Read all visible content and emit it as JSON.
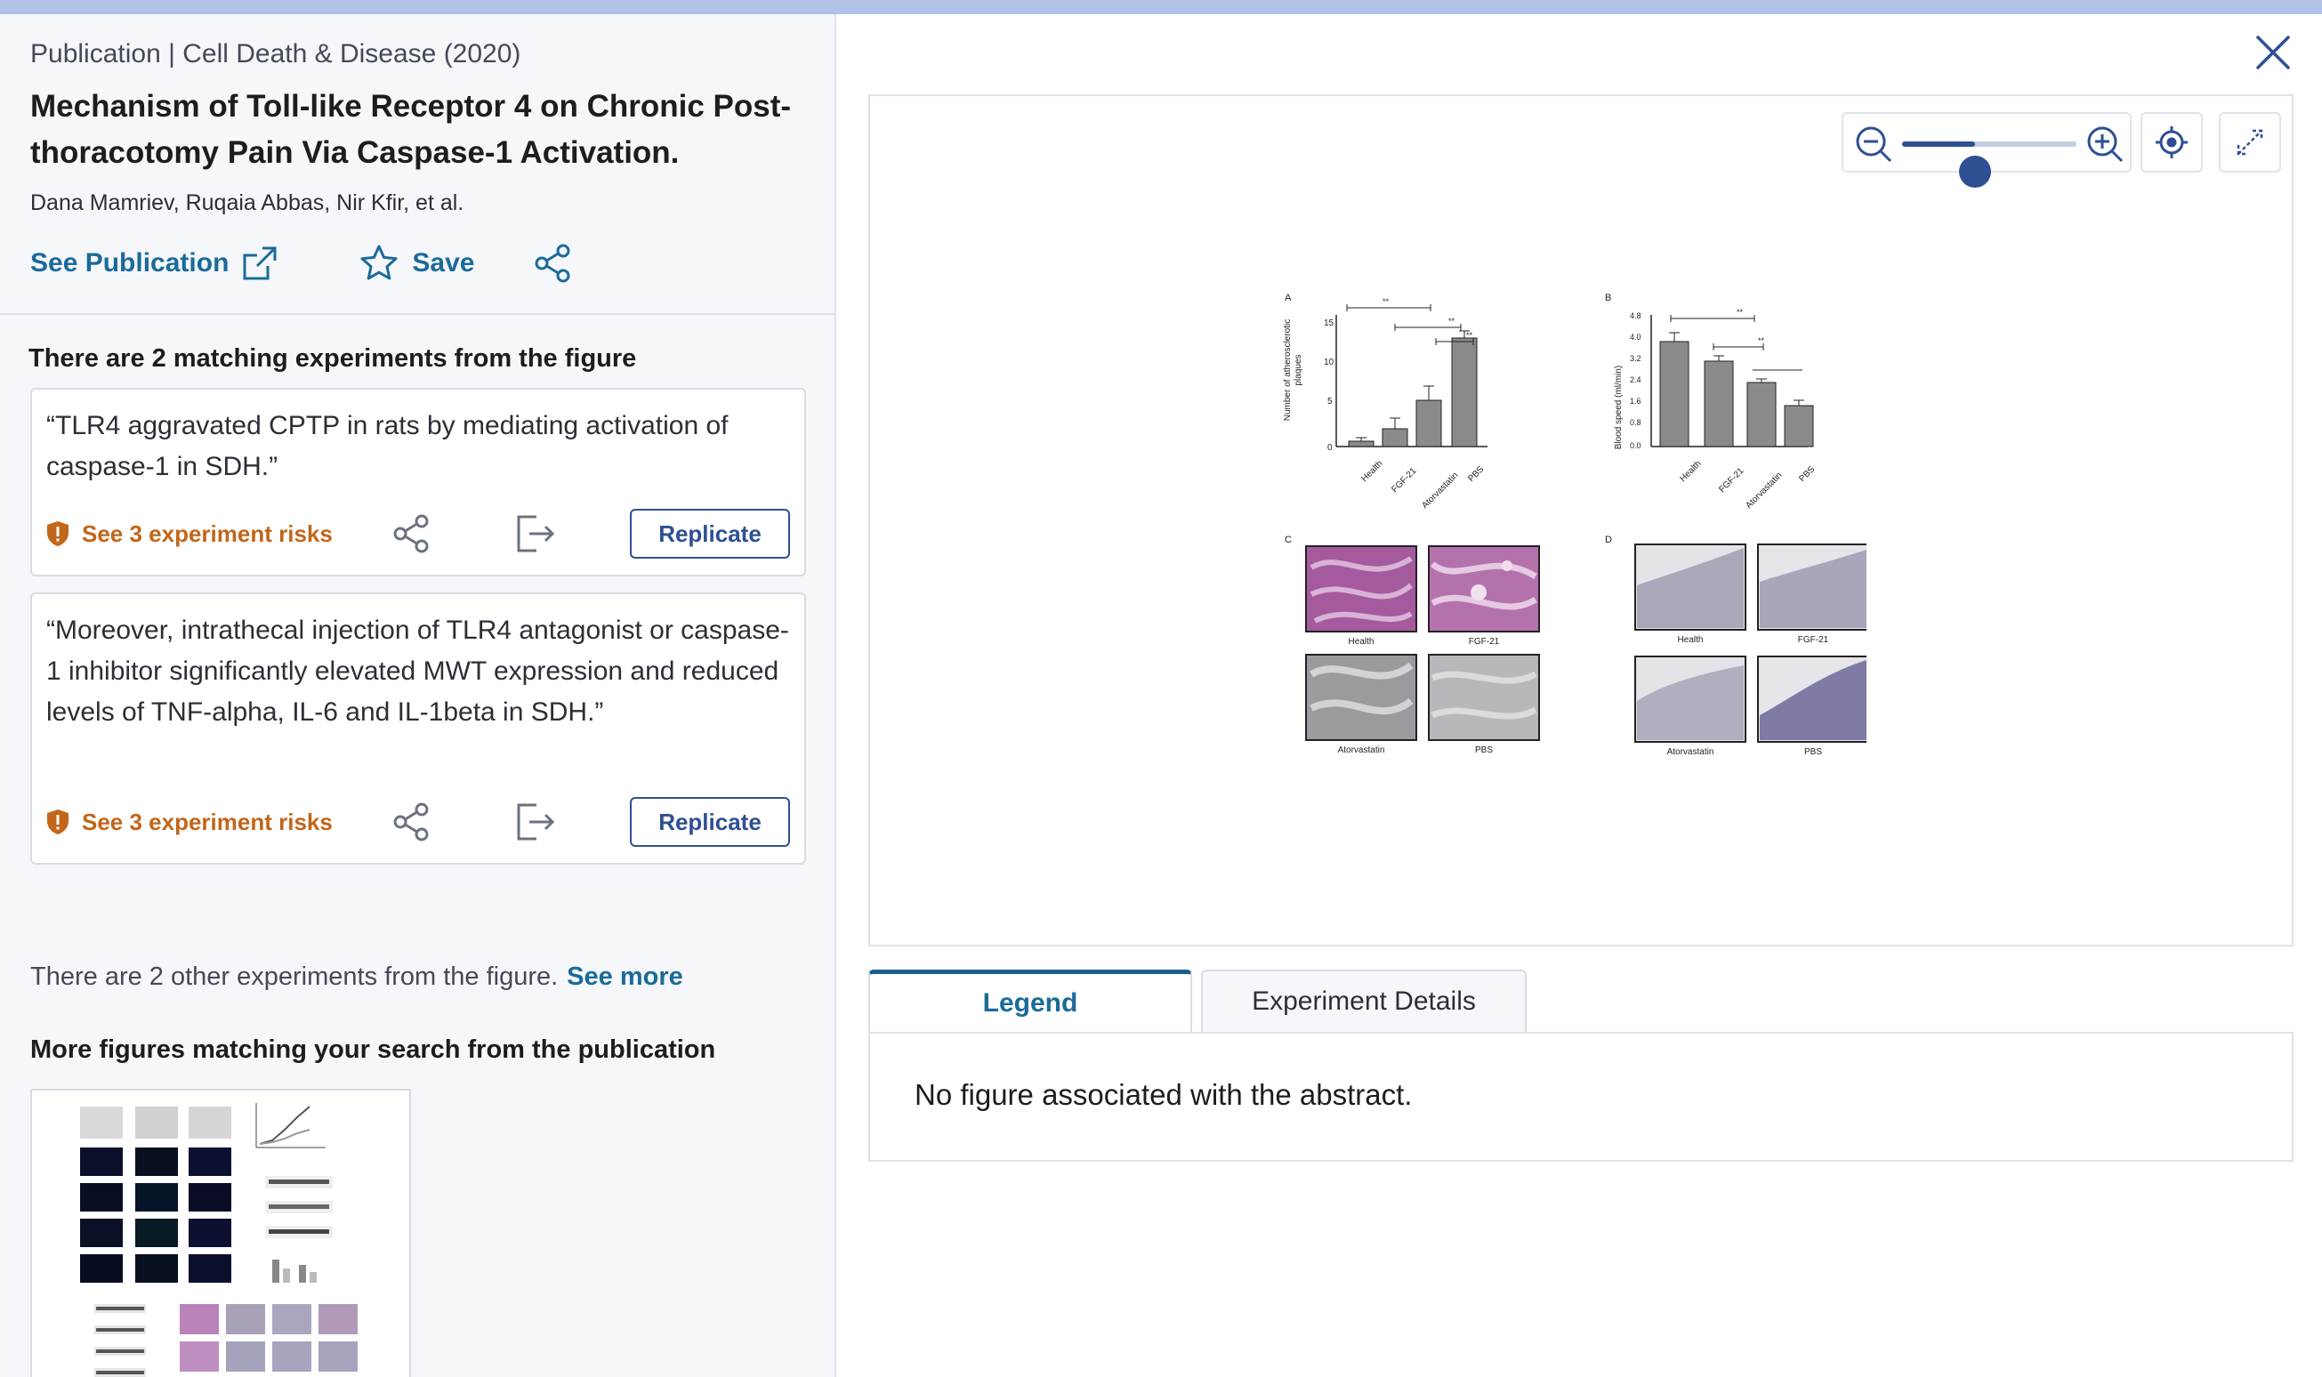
{
  "publication": {
    "source": "Publication | Cell Death & Disease  (2020)",
    "title": "Mechanism of Toll-like Receptor 4 on Chronic Post-thoracotomy Pain Via Caspase-1 Activation.",
    "authors": "Dana Mamriev, Ruqaia Abbas, Nir Kfir, et al.",
    "see_publication_label": "See Publication",
    "save_label": "Save"
  },
  "matching": {
    "title": "There are 2 matching experiments from the figure",
    "experiments": [
      {
        "quote": "“TLR4 aggravated CPTP in rats by mediating activation of caspase-1 in SDH.”",
        "risks_label": "See 3 experiment risks",
        "replicate_label": "Replicate"
      },
      {
        "quote": "“Moreover, intrathecal injection of TLR4 antagonist or caspase-1 inhibitor significantly elevated MWT expression and reduced levels of TNF-alpha, IL-6 and IL-1beta in SDH.”",
        "risks_label": "See 3 experiment risks",
        "replicate_label": "Replicate"
      }
    ]
  },
  "other_experiments": {
    "text": "There are 2 other experiments from the figure.",
    "see_more_label": "See more"
  },
  "more_figures": {
    "title": "More figures matching your search from the publication"
  },
  "viewer": {
    "zoom_level": 0.42,
    "figure": {
      "panel_a": {
        "letter": "A",
        "ylabel_line1": "Number of atherosclerotic",
        "ylabel_line2": "plaques",
        "ticks": [
          "15",
          "10",
          "5",
          "0"
        ],
        "categories": [
          "Health",
          "FGF-21",
          "Atorvastatin",
          "PBS"
        ],
        "sig": [
          "**",
          "**",
          "**"
        ]
      },
      "panel_b": {
        "letter": "B",
        "ylabel": "Blood speed (ml/min)",
        "ticks": [
          "4.8",
          "4.0",
          "3.2",
          "2.4",
          "1.6",
          "0.8",
          "0.0"
        ],
        "categories": [
          "Health",
          "FGF-21",
          "Atorvastatin",
          "PBS"
        ],
        "sig": [
          "**",
          "**"
        ]
      },
      "panel_c": {
        "letter": "C",
        "labels": [
          "Health",
          "FGF-21",
          "Atorvastatin",
          "PBS"
        ]
      },
      "panel_d": {
        "letter": "D",
        "labels": [
          "Health",
          "FGF-21",
          "Atorvastatin",
          "PBS"
        ]
      }
    }
  },
  "tabs": {
    "legend_label": "Legend",
    "details_label": "Experiment Details",
    "legend_text": "No figure associated with the abstract."
  },
  "colors": {
    "link": "#1a6b9a",
    "risk": "#c2661a",
    "primary": "#2f4f93",
    "topbar": "#b3c2e6"
  }
}
